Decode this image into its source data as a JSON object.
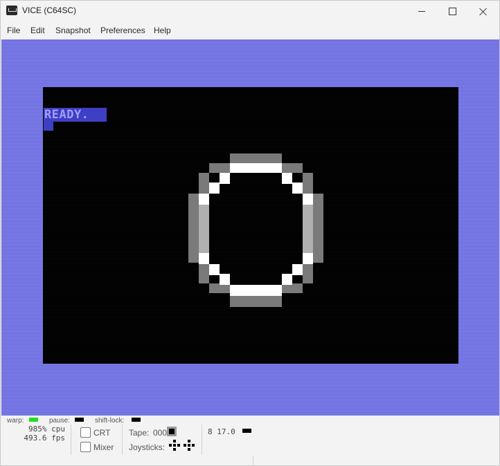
{
  "window": {
    "title": "VICE (C64SC)"
  },
  "menu": [
    "File",
    "Edit",
    "Snapshot",
    "Preferences",
    "Help"
  ],
  "screen": {
    "text": "READY."
  },
  "status": {
    "warp_label": "warp:",
    "pause_label": "pause:",
    "shiftlock_label": "shift-lock:",
    "cpu": "985% cpu",
    "fps": "493.6 fps",
    "crt_label": "CRT",
    "mixer_label": "Mixer",
    "tape_label": "Tape:",
    "tape_counter": "000",
    "joysticks_label": "Joysticks:",
    "drive_status": "8 17.0"
  },
  "colors": {
    "border": "#7a7ae6",
    "screen_bg": "#000000",
    "ready_bg": "#3f3fc4",
    "warp_led": "#22dd22",
    "pause_led": "#000000",
    "shiftlock_led": "#000000",
    "drive_led": "#000000"
  }
}
